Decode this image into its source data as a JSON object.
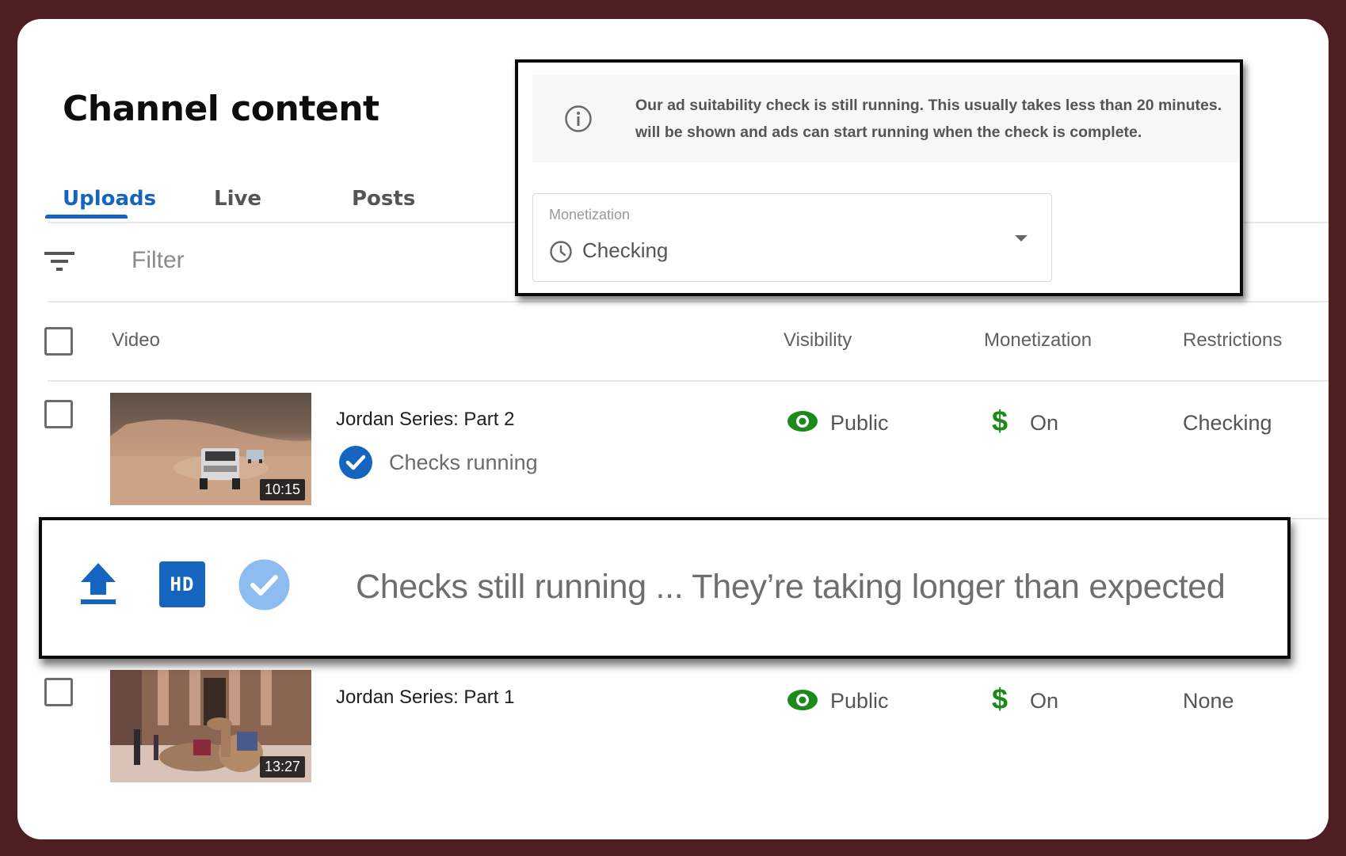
{
  "page": {
    "title": "Channel content",
    "colors": {
      "frame": "#4e1e22",
      "accent": "#1565c0",
      "success_green": "#1b8a1b",
      "check_light_blue": "#8cbcf0"
    }
  },
  "tabs": [
    {
      "label": "Uploads",
      "active": true
    },
    {
      "label": "Live",
      "active": false
    },
    {
      "label": "Posts",
      "active": false
    }
  ],
  "filter": {
    "icon": "filter-lines-icon",
    "placeholder": "Filter"
  },
  "table": {
    "columns": [
      "Video",
      "Visibility",
      "Monetization",
      "Restrictions"
    ],
    "rows": [
      {
        "title": "Jordan Series: Part 2",
        "duration": "10:15",
        "thumbnail": "desert jeeps",
        "status": "Checks running",
        "visibility": "Public",
        "monetization": "On",
        "restrictions": "Checking"
      },
      {
        "title": "Jordan Series: Part 1",
        "duration": "13:27",
        "thumbnail": "Petra camels",
        "visibility": "Public",
        "monetization": "On",
        "restrictions": "None"
      }
    ]
  },
  "popup": {
    "info_line1": "Our ad suitability check is still running. This usually takes less than 20 minutes.",
    "info_line2": "will be shown and ads can start running when the check is complete.",
    "select_label": "Monetization",
    "select_value": "Checking"
  },
  "banner": {
    "icons": [
      "upload-icon",
      "hd-icon",
      "check-circle-icon"
    ],
    "hd_label": "HD",
    "text": "Checks still running ... They’re taking longer than expected"
  }
}
